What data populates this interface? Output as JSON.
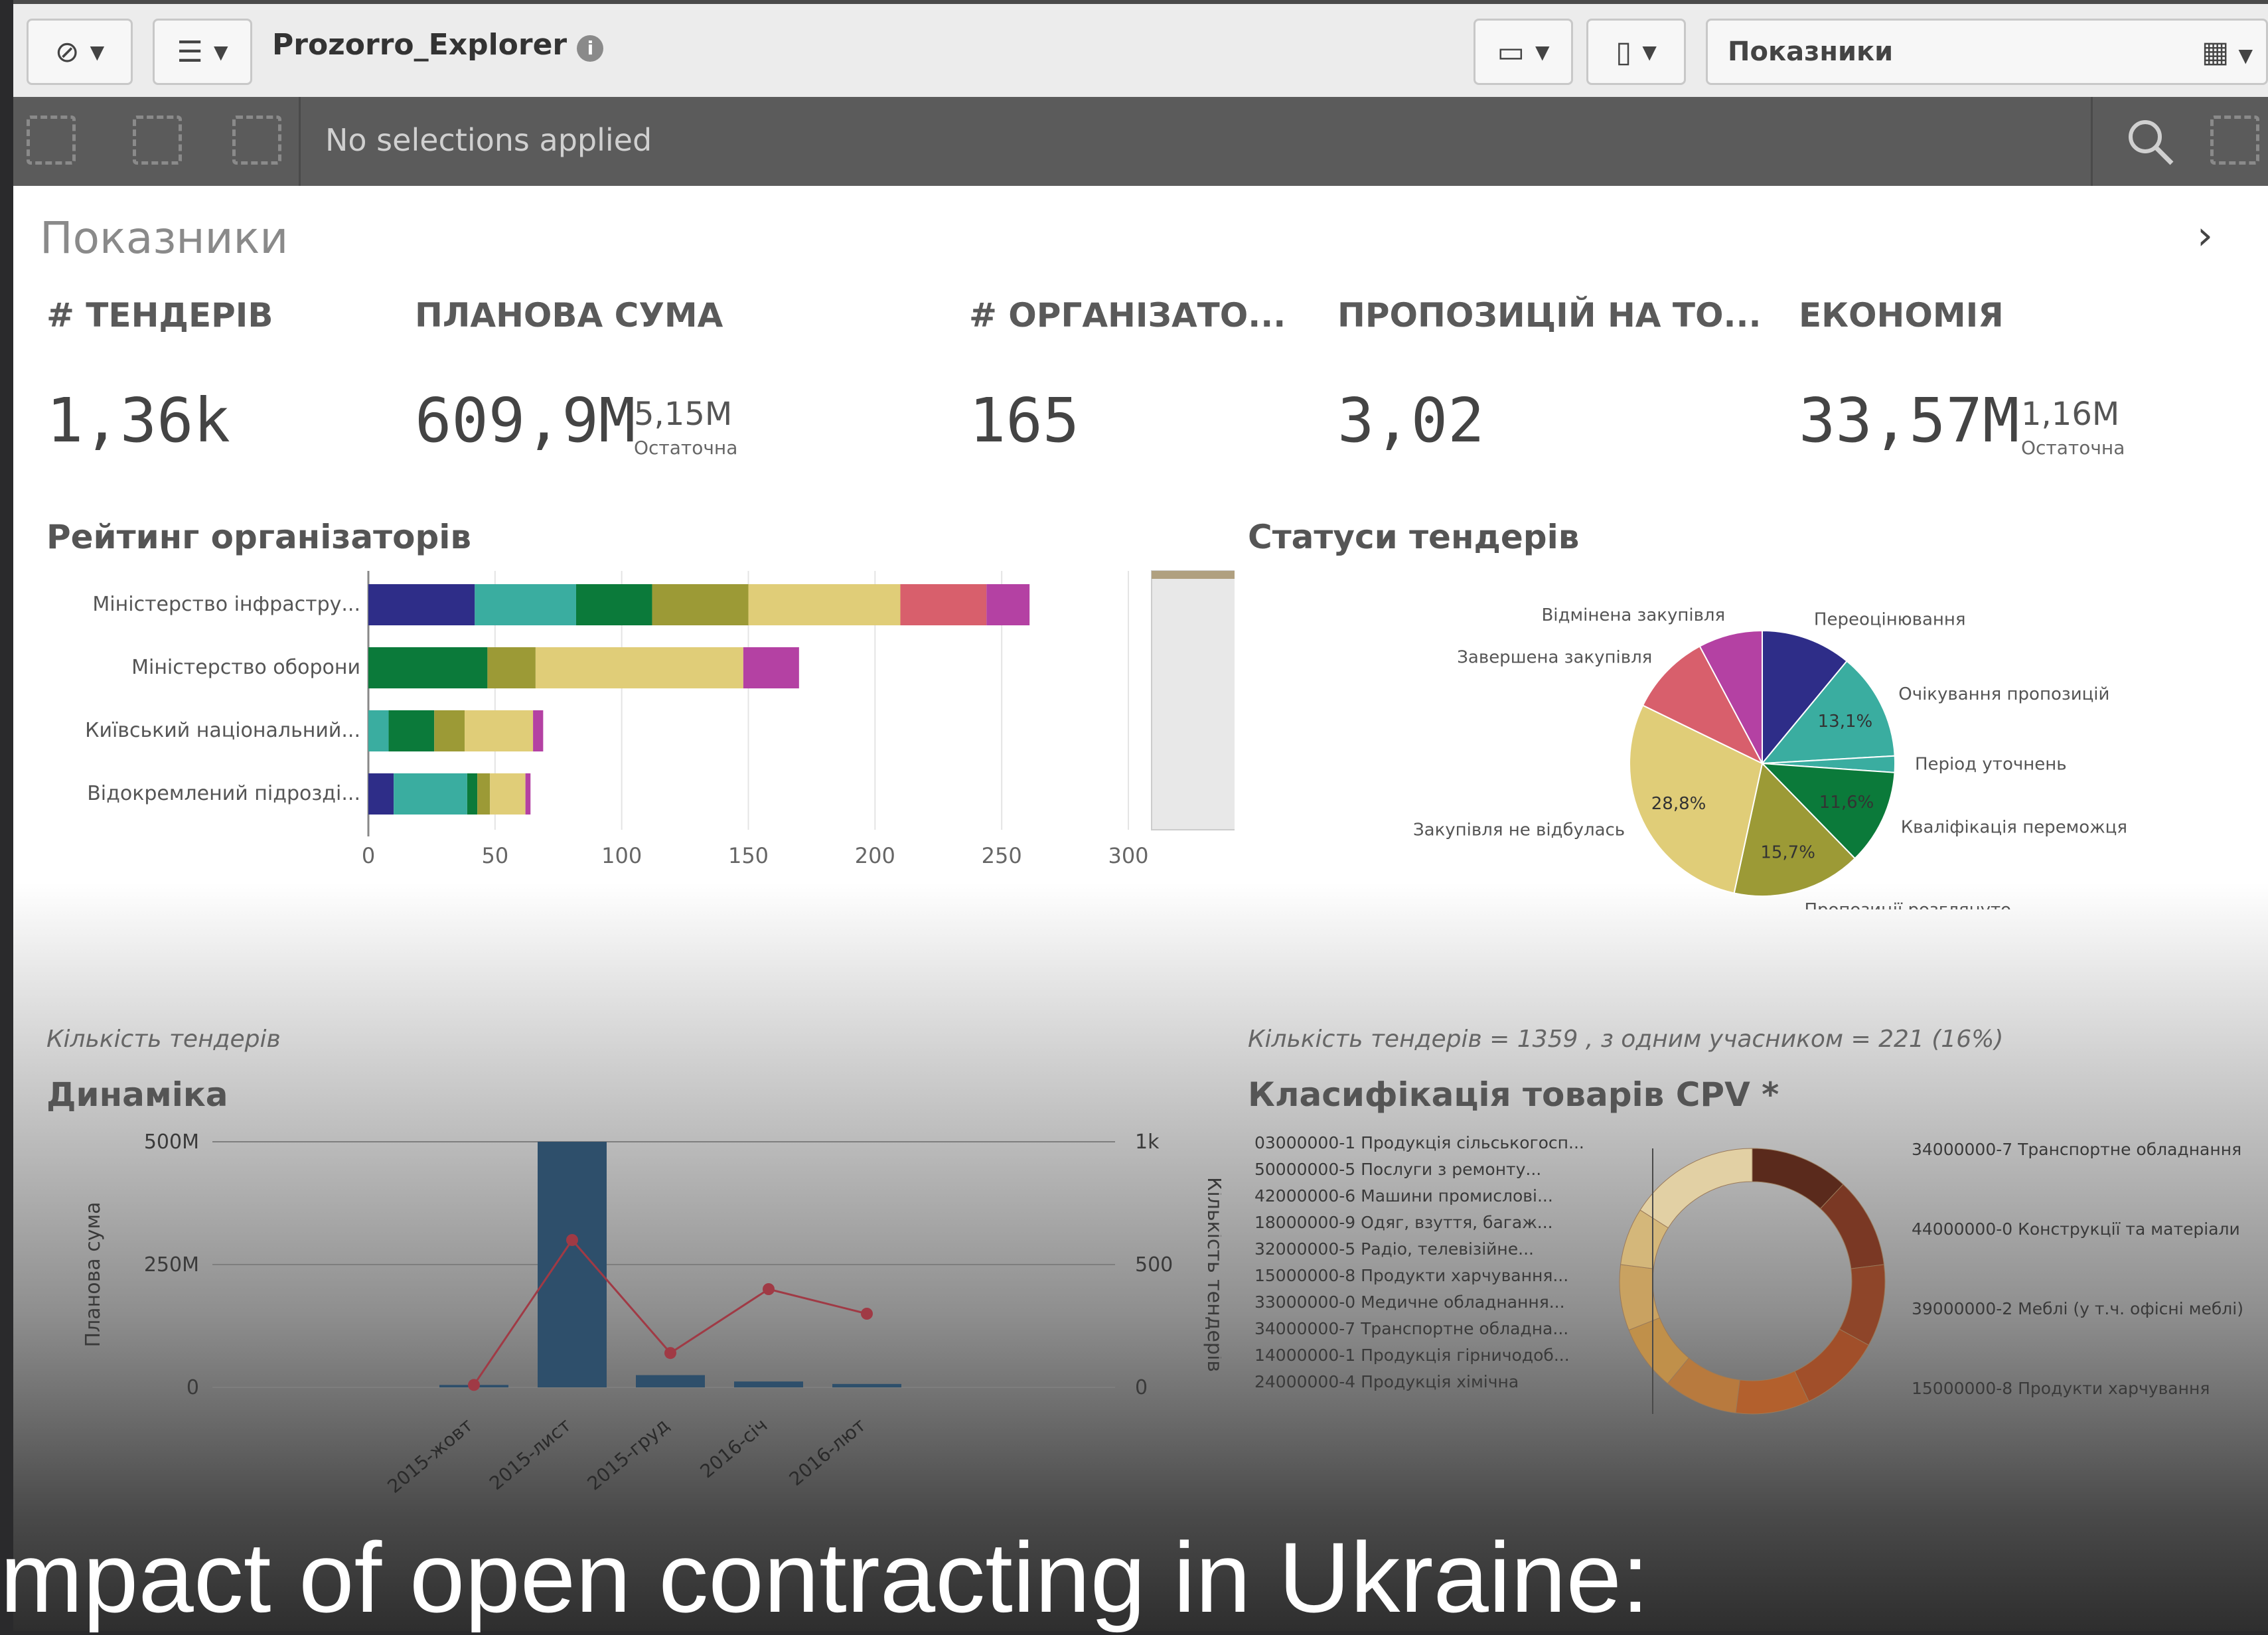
{
  "toolbar": {
    "app_title": "Prozorro_Explorer",
    "info_glyph": "i",
    "sheet_select": "Показники",
    "icons": [
      "compass-icon",
      "list-icon",
      "present-icon",
      "bookmark-icon",
      "chart-icon"
    ]
  },
  "selections": {
    "text": "No selections applied"
  },
  "sheet": {
    "title": "Показники",
    "kpis": [
      {
        "label": "# ТЕНДЕРІВ",
        "value": "1,36k"
      },
      {
        "label": "ПЛАНОВА СУМА",
        "value": "609,9M",
        "sub": "5,15M",
        "note": "Остаточна"
      },
      {
        "label": "# ОРГАНІЗАТО...",
        "value": "165"
      },
      {
        "label": "ПРОПОЗИЦІЙ НА ТО...",
        "value": "3,02"
      },
      {
        "label": "ЕКОНОМІЯ",
        "value": "33,57M",
        "sub": "1,16M",
        "note": "Остаточна"
      }
    ],
    "rating_title": "Рейтинг організаторів",
    "status_title": "Статуси тендерів",
    "dynamics_caption": "Кількість тендерів",
    "dynamics_title": "Динаміка",
    "cpv_caption": "Кількість тендерів = 1359 , з одним учасником = 221 (16%)",
    "cpv_title": "Класифікація товарів CPV *",
    "caption_text": "mpact of open contracting in Ukraine:"
  },
  "chart_data": [
    {
      "type": "bar",
      "title": "Рейтинг організаторів",
      "orientation": "horizontal",
      "stacked": true,
      "categories": [
        "Міністерство інфрастру...",
        "Міністерство оборони",
        "Київський національний...",
        "Відокремлений підрозді..."
      ],
      "xticks": [
        "0",
        "50",
        "100",
        "150",
        "200",
        "250",
        "300"
      ],
      "xlim": [
        0,
        300
      ],
      "segments": [
        [
          {
            "value": 42,
            "color": "#2e2d88"
          },
          {
            "value": 40,
            "color": "#3aada0"
          },
          {
            "value": 30,
            "color": "#0b7a3a"
          },
          {
            "value": 38,
            "color": "#9c9a36"
          },
          {
            "value": 60,
            "color": "#e0cd78"
          },
          {
            "value": 34,
            "color": "#d85f6c"
          },
          {
            "value": 17,
            "color": "#b441a3"
          }
        ],
        [
          {
            "value": 47,
            "color": "#0b7a3a"
          },
          {
            "value": 19,
            "color": "#9c9a36"
          },
          {
            "value": 82,
            "color": "#e0cd78"
          },
          {
            "value": 22,
            "color": "#b441a3"
          }
        ],
        [
          {
            "value": 8,
            "color": "#3aada0"
          },
          {
            "value": 18,
            "color": "#0b7a3a"
          },
          {
            "value": 12,
            "color": "#9c9a36"
          },
          {
            "value": 27,
            "color": "#e0cd78"
          },
          {
            "value": 4,
            "color": "#b441a3"
          }
        ],
        [
          {
            "value": 10,
            "color": "#2e2d88"
          },
          {
            "value": 29,
            "color": "#3aada0"
          },
          {
            "value": 4,
            "color": "#0b7a3a"
          },
          {
            "value": 5,
            "color": "#9c9a36"
          },
          {
            "value": 14,
            "color": "#e0cd78"
          },
          {
            "value": 2,
            "color": "#b441a3"
          }
        ]
      ]
    },
    {
      "type": "pie",
      "title": "Статуси тендерів",
      "slices": [
        {
          "label": "Переоцінювання",
          "value": 11,
          "color": "#2e2d88"
        },
        {
          "label": "Очікування пропозицій",
          "value": 13.1,
          "color": "#3aada0",
          "pct": "13,1%"
        },
        {
          "label": "Період уточнень",
          "value": 2,
          "color": "#3aada0"
        },
        {
          "label": "Кваліфікація переможця",
          "value": 11.6,
          "color": "#0b7a3a",
          "pct": "11,6%"
        },
        {
          "label": "Пропозиції розглянуто",
          "value": 15.7,
          "color": "#9c9a36",
          "pct": "15,7%"
        },
        {
          "label": "Закупівля не відбулась",
          "value": 28.8,
          "color": "#e0cd78",
          "pct": "28,8%"
        },
        {
          "label": "Завершена закупівля",
          "value": 10,
          "color": "#d85f6c"
        },
        {
          "label": "Відмінена закупівля",
          "value": 7.8,
          "color": "#b441a3"
        }
      ]
    },
    {
      "type": "bar",
      "title": "Динаміка",
      "ylabel": "Планова сума",
      "y2label": "Кількість тендерів",
      "categories": [
        "2015-жовт",
        "2015-лист",
        "2015-груд",
        "2016-січ",
        "2016-лют"
      ],
      "bar_values": [
        5,
        500,
        25,
        12,
        7
      ],
      "line_values": [
        10,
        600,
        140,
        400,
        300
      ],
      "ylim": [
        0,
        500
      ],
      "y2lim": [
        0,
        1000
      ],
      "yticks": [
        "500M",
        "250M",
        "0"
      ],
      "y2ticks": [
        "1k",
        "500",
        "0"
      ]
    },
    {
      "type": "pie",
      "title": "Класифікація товарів CPV *",
      "donut": true,
      "left_labels": [
        "03000000-1 Продукція сільськогосп...",
        "50000000-5 Послуги з ремонту...",
        "42000000-6 Машини промислові...",
        "18000000-9 Одяг, взуття, багаж...",
        "32000000-5 Радіо, телевізійне...",
        "15000000-8 Продукти харчування...",
        "33000000-0 Медичне обладнання...",
        "34000000-7 Транспортне обладна...",
        "14000000-1 Продукція гірничодоб...",
        "24000000-4 Продукція хімічна"
      ],
      "right_labels": [
        "34000000-7 Транспортне обладнання",
        "44000000-0 Конструкції та матеріали",
        "39000000-2 Меблі (у т.ч. офісні меблі)",
        "15000000-8 Продукти харчування"
      ],
      "colors": [
        "#5a2a1c",
        "#7a3824",
        "#8e4529",
        "#a14f2a",
        "#b3602d",
        "#b87a3e",
        "#c0904a",
        "#c9a261",
        "#d4b77a",
        "#e2d0a4"
      ]
    }
  ]
}
